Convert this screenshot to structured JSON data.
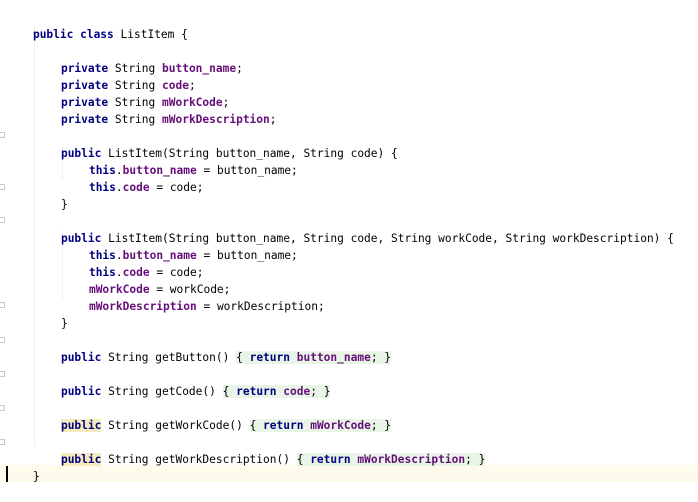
{
  "lines": {
    "l01": {
      "a": "public class",
      "b": " ListItem {"
    },
    "l02": {
      "a": "private",
      "b": " String ",
      "c": "button_name",
      "d": ";"
    },
    "l03": {
      "a": "private",
      "b": " String ",
      "c": "code",
      "d": ";"
    },
    "l04": {
      "a": "private",
      "b": " String ",
      "c": "mWorkCode",
      "d": ";"
    },
    "l05": {
      "a": "private",
      "b": " String ",
      "c": "mWorkDescription",
      "d": ";"
    },
    "l06": {
      "a": "public",
      "b": " ListItem(String button_name, String code) {"
    },
    "l07": {
      "a": "this",
      "b": ".",
      "c": "button_name",
      "d": " = button_name;"
    },
    "l08": {
      "a": "this",
      "b": ".",
      "c": "code",
      "d": " = code;"
    },
    "l09": {
      "a": "}"
    },
    "l10": {
      "a": "public",
      "b": " ListItem(String button_name, String code, String workCode, String workDescription) {"
    },
    "l11": {
      "a": "this",
      "b": ".",
      "c": "button_name",
      "d": " = button_name;"
    },
    "l12": {
      "a": "this",
      "b": ".",
      "c": "code",
      "d": " = code;"
    },
    "l13": {
      "a": "mWorkCode",
      "b": " = workCode;"
    },
    "l14": {
      "a": "mWorkDescription",
      "b": " = workDescription;"
    },
    "l15": {
      "a": "}"
    },
    "l16": {
      "a": "public",
      "b": " String getButton() ",
      "c": "{ ",
      "d": "return",
      "e": " button_name",
      "f": "; }"
    },
    "l17": {
      "a": "public",
      "b": " String getCode() ",
      "c": "{ ",
      "d": "return",
      "e": " code",
      "f": "; }"
    },
    "l18": {
      "a": "public",
      "b": " String getWorkCode() ",
      "c": "{ ",
      "d": "return",
      "e": " mWorkCode",
      "f": "; }"
    },
    "l19": {
      "a": "public",
      "b": " String getWorkDescription() ",
      "c": "{ ",
      "d": "return",
      "e": " mWorkDescription",
      "f": "; }"
    },
    "l20": {
      "a": "}"
    }
  },
  "colors": {
    "keyword": "#000080",
    "field": "#660e7a",
    "folded_region_bg": "#e9f5e6",
    "highlight_bg": "#f6ebbc",
    "current_line_bg": "#fefbec"
  }
}
